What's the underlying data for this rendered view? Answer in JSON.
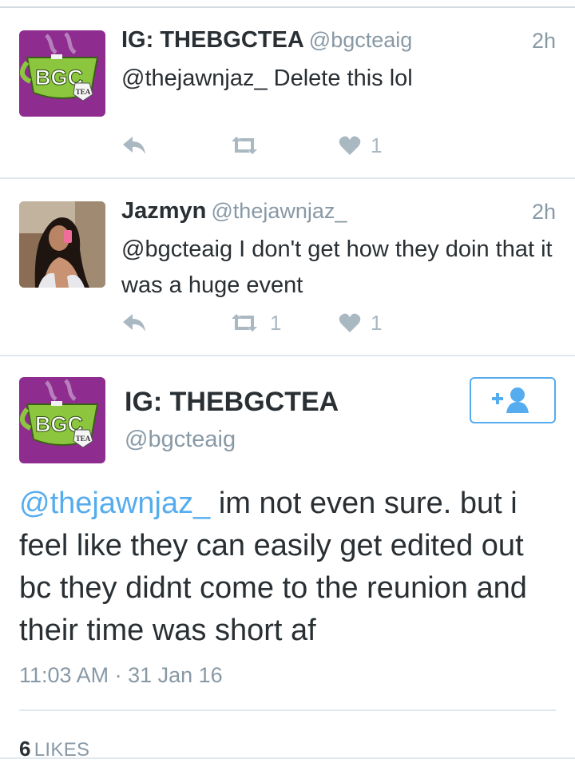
{
  "tweets": [
    {
      "name": "IG: THEBGCTEA",
      "handle": "@bgcteaig",
      "time": "2h",
      "text": "@thejawnjaz_ Delete this lol",
      "retweets": "",
      "likes": "1",
      "avatar": {
        "logo_text": "BGC",
        "logo_tag": "TEA",
        "logo_small": "THE"
      }
    },
    {
      "name": "Jazmyn",
      "handle": "@thejawnjaz_",
      "time": "2h",
      "text": "@bgcteaig I don't get how they doin that it was a huge event",
      "retweets": "1",
      "likes": "1"
    }
  ],
  "main_tweet": {
    "name": "IG: THEBGCTEA",
    "handle": "@bgcteaig",
    "mention": "@thejawnjaz_",
    "text": " im not even sure. but i feel like they can easily get edited out bc they didnt come to the reunion and their time was short af",
    "datetime": "11:03 AM · 31 Jan 16",
    "likes_count": "6",
    "likes_label": "LIKES",
    "avatar": {
      "logo_text": "BGC",
      "logo_tag": "TEA",
      "logo_small": "THE"
    }
  },
  "icons": {
    "reply": "reply-icon",
    "retweet": "retweet-icon",
    "like": "heart-icon",
    "follow": "follow-user-icon"
  },
  "colors": {
    "link": "#55acee",
    "muted": "#8899a6",
    "icon": "#aab8c2",
    "avatar_bg": "#8e2c8f",
    "logo_green": "#8cc63f"
  }
}
